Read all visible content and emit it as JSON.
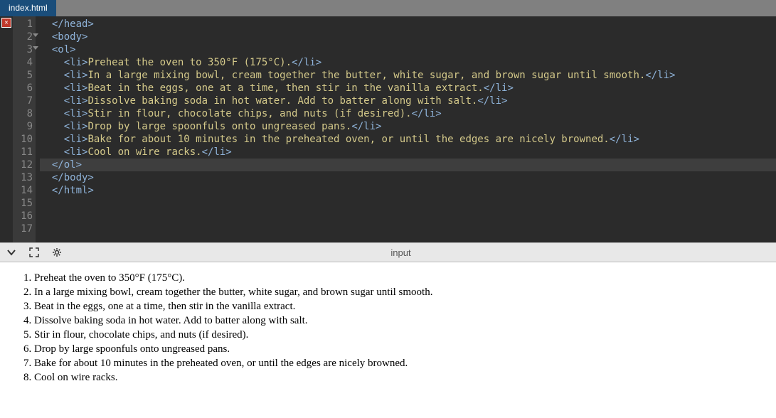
{
  "tab": {
    "label": "index.html"
  },
  "gutter": {
    "count": 17
  },
  "code": {
    "lines": [
      {
        "i": "  ",
        "tag1": "</head>",
        "txt": "",
        "tag2": ""
      },
      {
        "i": "  ",
        "tag1": "<body>",
        "txt": "",
        "tag2": ""
      },
      {
        "i": "  ",
        "tag1": "<ol>",
        "txt": "",
        "tag2": ""
      },
      {
        "i": "    ",
        "tag1": "<li>",
        "txt": "Preheat the oven to 350°F (175°C).",
        "tag2": "</li>"
      },
      {
        "i": "    ",
        "tag1": "<li>",
        "txt": "In a large mixing bowl, cream together the butter, white sugar, and brown sugar until smooth.",
        "tag2": "</li>"
      },
      {
        "i": "    ",
        "tag1": "<li>",
        "txt": "Beat in the eggs, one at a time, then stir in the vanilla extract.",
        "tag2": "</li>"
      },
      {
        "i": "    ",
        "tag1": "<li>",
        "txt": "Dissolve baking soda in hot water. Add to batter along with salt.",
        "tag2": "</li>"
      },
      {
        "i": "    ",
        "tag1": "<li>",
        "txt": "Stir in flour, chocolate chips, and nuts (if desired).",
        "tag2": "</li>"
      },
      {
        "i": "    ",
        "tag1": "<li>",
        "txt": "Drop by large spoonfuls onto ungreased pans.",
        "tag2": "</li>"
      },
      {
        "i": "    ",
        "tag1": "<li>",
        "txt": "Bake for about 10 minutes in the preheated oven, or until the edges are nicely browned.",
        "tag2": "</li>"
      },
      {
        "i": "    ",
        "tag1": "<li>",
        "txt": "Cool on wire racks.",
        "tag2": "</li>"
      },
      {
        "i": "  ",
        "tag1": "</ol>",
        "txt": "",
        "tag2": ""
      },
      {
        "i": "  ",
        "tag1": "</body>",
        "txt": "",
        "tag2": ""
      },
      {
        "i": "  ",
        "tag1": "</html>",
        "txt": "",
        "tag2": ""
      },
      {
        "i": "",
        "tag1": "",
        "txt": "",
        "tag2": ""
      },
      {
        "i": "",
        "tag1": "",
        "txt": "",
        "tag2": ""
      },
      {
        "i": "",
        "tag1": "",
        "txt": "",
        "tag2": ""
      }
    ],
    "highlight_index": 11,
    "fold_lines": [
      1,
      2
    ]
  },
  "statusbar": {
    "label": "input"
  },
  "output": {
    "items": [
      "Preheat the oven to 350°F (175°C).",
      "In a large mixing bowl, cream together the butter, white sugar, and brown sugar until smooth.",
      "Beat in the eggs, one at a time, then stir in the vanilla extract.",
      "Dissolve baking soda in hot water. Add to batter along with salt.",
      "Stir in flour, chocolate chips, and nuts (if desired).",
      "Drop by large spoonfuls onto ungreased pans.",
      "Bake for about 10 minutes in the preheated oven, or until the edges are nicely browned.",
      "Cool on wire racks."
    ]
  }
}
